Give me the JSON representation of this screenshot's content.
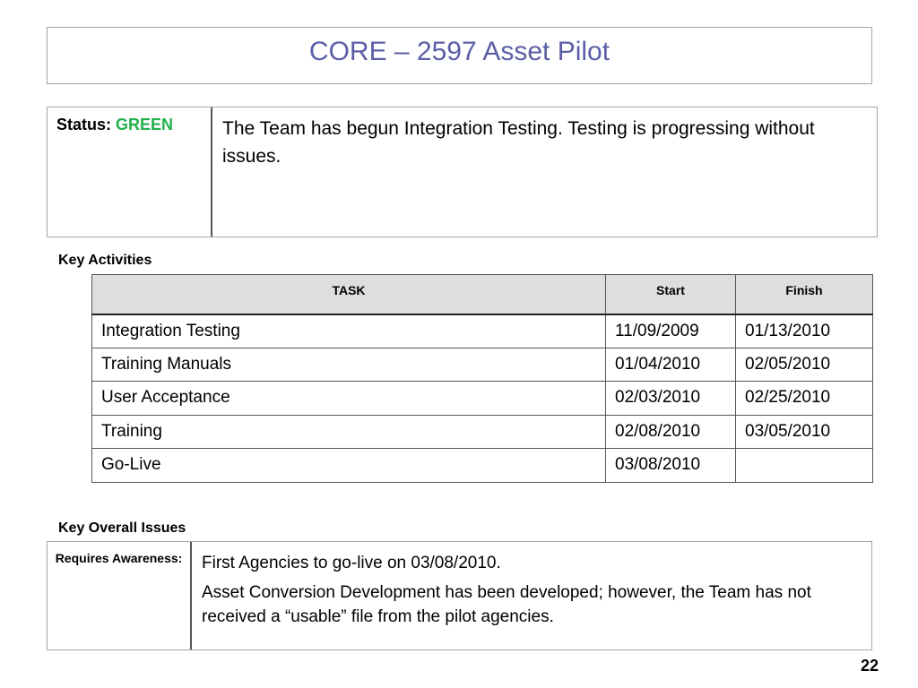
{
  "title": "CORE – 2597 Asset Pilot",
  "status": {
    "label": "Status:",
    "value": "GREEN",
    "value_color": "#22b04b",
    "text": "The Team has begun Integration Testing.  Testing is progressing without issues."
  },
  "key_activities": {
    "heading": "Key Activities",
    "columns": [
      "TASK",
      "Start",
      "Finish"
    ],
    "rows": [
      {
        "task": "Integration Testing",
        "start": "11/09/2009",
        "finish": "01/13/2010"
      },
      {
        "task": "Training Manuals",
        "start": "01/04/2010",
        "finish": "02/05/2010"
      },
      {
        "task": "User Acceptance",
        "start": "02/03/2010",
        "finish": "02/25/2010"
      },
      {
        "task": "Training",
        "start": "02/08/2010",
        "finish": "03/05/2010"
      },
      {
        "task": "Go-Live",
        "start": "03/08/2010",
        "finish": ""
      }
    ]
  },
  "key_overall_issues": {
    "heading": "Key Overall Issues",
    "label": "Requires Awareness:",
    "paragraphs": [
      "First Agencies to go-live on 03/08/2010.",
      "Asset Conversion Development has been developed; however, the Team has not received a “usable” file from the pilot agencies."
    ]
  },
  "page_number": "22",
  "colors": {
    "title": "#5b5ea6",
    "header_bg": "#dedede"
  }
}
